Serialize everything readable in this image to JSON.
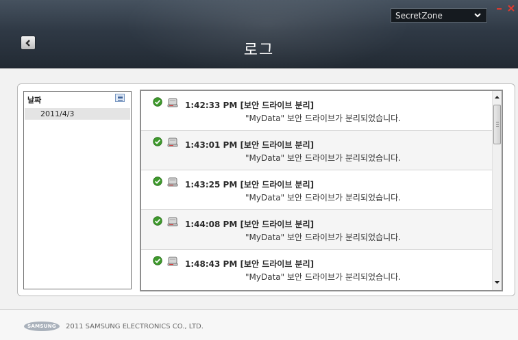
{
  "header": {
    "title": "로그",
    "back_icon": "chevron-left-icon",
    "zone_select": {
      "value": "SecretZone",
      "icon": "chevron-down-icon"
    },
    "minimize_label": "-",
    "close_label": "×"
  },
  "date_panel": {
    "header_label": "날짜",
    "view_icon": "list-icon",
    "items": [
      {
        "label": "2011/4/3"
      }
    ]
  },
  "log_panel": {
    "entries": [
      {
        "time": "1:42:33 PM",
        "event": "[보안 드라이브 분리]",
        "message": "\"MyData\" 보안 드라이브가 분리되었습니다."
      },
      {
        "time": "1:43:01 PM",
        "event": "[보안 드라이브 분리]",
        "message": "\"MyData\" 보안 드라이브가 분리되었습니다."
      },
      {
        "time": "1:43:25 PM",
        "event": "[보안 드라이브 분리]",
        "message": "\"MyData\" 보안 드라이브가 분리되었습니다."
      },
      {
        "time": "1:44:08 PM",
        "event": "[보안 드라이브 분리]",
        "message": "\"MyData\" 보안 드라이브가 분리되었습니다."
      },
      {
        "time": "1:48:43 PM",
        "event": "[보안 드라이브 분리]",
        "message": "\"MyData\" 보안 드라이브가 분리되었습니다."
      }
    ],
    "status_icon": "check-icon",
    "drive_icon": "drive-icon"
  },
  "footer": {
    "logo_text": "SAMSUNG",
    "copyright": "2011 SAMSUNG ELECTRONICS CO., LTD."
  },
  "colors": {
    "header_bg": "#2f3945",
    "close_red": "#e03a2e",
    "check_green": "#3e9a2c"
  }
}
